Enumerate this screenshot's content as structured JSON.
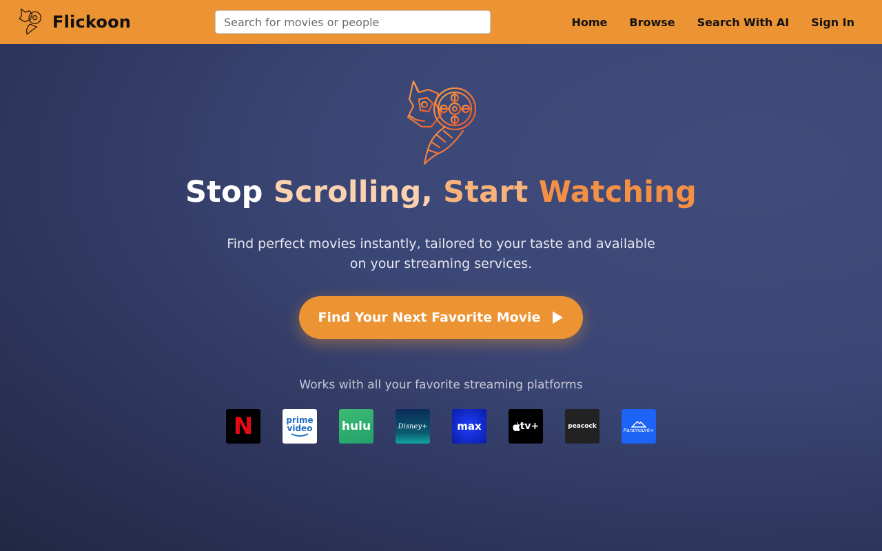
{
  "nav": {
    "brand_name": "Flickoon",
    "search_placeholder": "Search for movies or people",
    "links": [
      "Home",
      "Browse",
      "Search With AI",
      "Sign In"
    ]
  },
  "hero": {
    "headline_words": [
      "Stop",
      "Scrolling,",
      "Start",
      "Watching"
    ],
    "subtitle": "Find perfect movies instantly, tailored to your taste and available on your streaming services.",
    "cta_label": "Find Your Next Favorite Movie",
    "cta_icon": "play-icon"
  },
  "platforms": {
    "label": "Works with all your favorite streaming platforms",
    "items": [
      {
        "name": "netflix",
        "mark": "N"
      },
      {
        "name": "prime-video",
        "mark_line1": "prime",
        "mark_line2": "video"
      },
      {
        "name": "hulu",
        "mark": "hulu"
      },
      {
        "name": "disney-plus",
        "mark": "Disney+"
      },
      {
        "name": "max",
        "mark": "max"
      },
      {
        "name": "apple-tv-plus",
        "mark": "tv+"
      },
      {
        "name": "peacock",
        "mark": "peacock"
      },
      {
        "name": "paramount-plus",
        "mark": "Paramount+"
      }
    ]
  },
  "colors": {
    "accent": "#ec9333",
    "headline_white": "#ffffff",
    "headline_peach_light": "#fbd2b0",
    "headline_peach": "#f8b37a",
    "headline_orange": "#f39045",
    "background_dark": "#222843",
    "background_light": "#414c7c"
  }
}
